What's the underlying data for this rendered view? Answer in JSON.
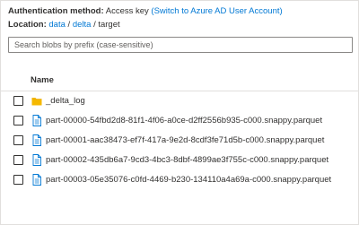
{
  "location_bar": {
    "auth_label": "Authentication method:",
    "auth_value": "Access key",
    "auth_switch_link": "(Switch to Azure AD User Account)",
    "location_label": "Location:",
    "crumbs": [
      {
        "text": "data",
        "link": true
      },
      {
        "text": "/",
        "link": false
      },
      {
        "text": "delta",
        "link": true
      },
      {
        "text": "/",
        "link": false
      },
      {
        "text": "target",
        "link": false
      }
    ]
  },
  "search": {
    "placeholder": "Search blobs by prefix (case-sensitive)",
    "value": ""
  },
  "table": {
    "header_name": "Name",
    "rows": [
      {
        "name": "_delta_log",
        "icon": "folder-icon"
      },
      {
        "name": "part-00000-54fbd2d8-81f1-4f06-a0ce-d2ff2556b935-c000.snappy.parquet",
        "icon": "file-icon"
      },
      {
        "name": "part-00001-aac38473-ef7f-417a-9e2d-8cdf3fe71d5b-c000.snappy.parquet",
        "icon": "file-icon"
      },
      {
        "name": "part-00002-435db6a7-9cd3-4bc3-8dbf-4899ae3f755c-c000.snappy.parquet",
        "icon": "file-icon"
      },
      {
        "name": "part-00003-05e35076-c0fd-4469-b230-134110a4a69a-c000.snappy.parquet",
        "icon": "file-icon"
      }
    ]
  },
  "colors": {
    "link": "#0078d4",
    "folder": "#f5b800",
    "file": "#0078d4",
    "border": "#e1dfdd"
  }
}
